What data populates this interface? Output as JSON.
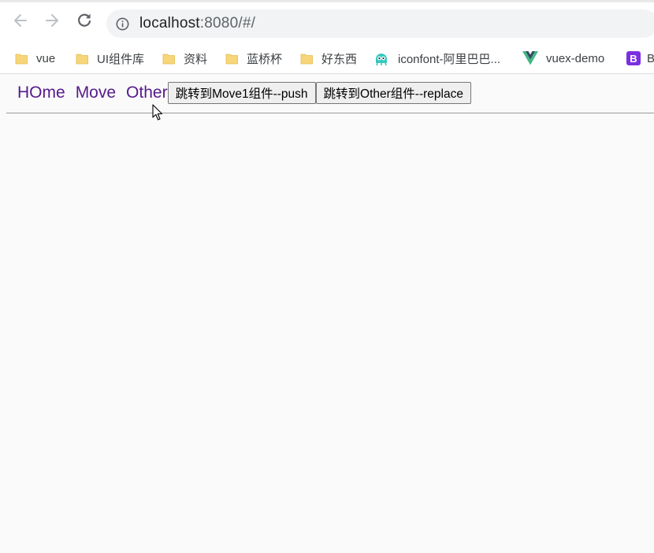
{
  "browser": {
    "url_host": "localhost",
    "url_rest": ":8080/#/",
    "bookmarks": [
      {
        "label": "vue",
        "icon": "folder-icon"
      },
      {
        "label": "UI组件库",
        "icon": "folder-icon"
      },
      {
        "label": "资料",
        "icon": "folder-icon"
      },
      {
        "label": "蓝桥杯",
        "icon": "folder-icon"
      },
      {
        "label": "好东西",
        "icon": "folder-icon"
      },
      {
        "label": "iconfont-阿里巴巴...",
        "icon": "iconfont-icon"
      },
      {
        "label": "vuex-demo",
        "icon": "vue-logo-icon"
      },
      {
        "label": "B",
        "icon": "bootstrap-icon"
      }
    ]
  },
  "app": {
    "nav_links": [
      "HOme",
      "Move",
      "Other"
    ],
    "push_button": "跳转到Move1组件--push",
    "replace_button": "跳转到Other组件--replace"
  },
  "colors": {
    "visited_link": "#551a8b",
    "page_background": "#fafafa",
    "omnibox_background": "#f1f3f4",
    "folder_icon": "#f7d67a",
    "vue_green": "#41b883",
    "vue_dark": "#35495e",
    "bootstrap_purple": "#7b2fe0",
    "iconfont_teal": "#35c8c0"
  }
}
